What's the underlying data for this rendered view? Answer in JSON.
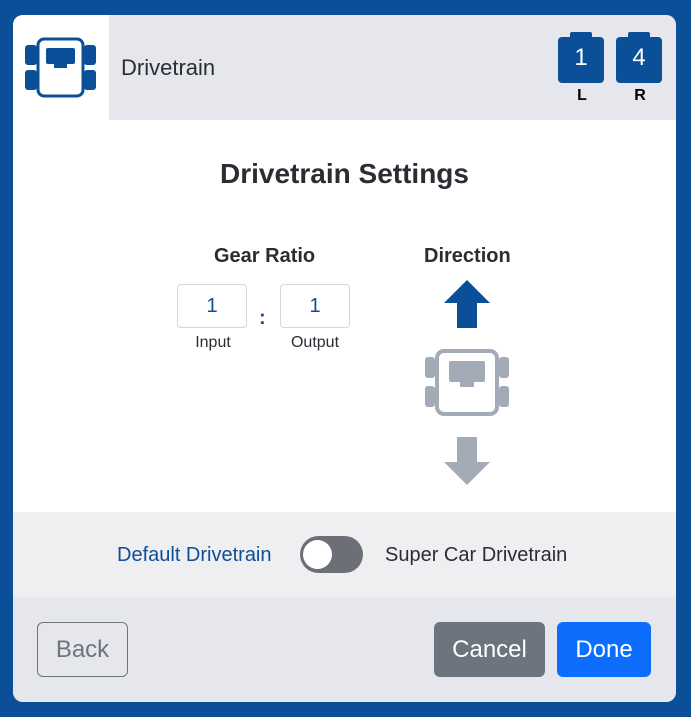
{
  "header": {
    "title": "Drivetrain",
    "ports": [
      {
        "number": "1",
        "side": "L"
      },
      {
        "number": "4",
        "side": "R"
      }
    ],
    "icon": "drivetrain-icon"
  },
  "main": {
    "title": "Drivetrain Settings",
    "gear_ratio": {
      "label": "Gear Ratio",
      "input_value": "1",
      "input_caption": "Input",
      "separator": ":",
      "output_value": "1",
      "output_caption": "Output"
    },
    "direction": {
      "label": "Direction",
      "selected": "forward"
    }
  },
  "toggle": {
    "left_label": "Default Drivetrain",
    "right_label": "Super Car Drivetrain",
    "state": "default"
  },
  "footer": {
    "back_label": "Back",
    "cancel_label": "Cancel",
    "done_label": "Done"
  },
  "colors": {
    "brand": "#0b4f98",
    "primary": "#0d6efd",
    "muted": "#6c757d",
    "inactive_arrow": "#a3abb7"
  }
}
